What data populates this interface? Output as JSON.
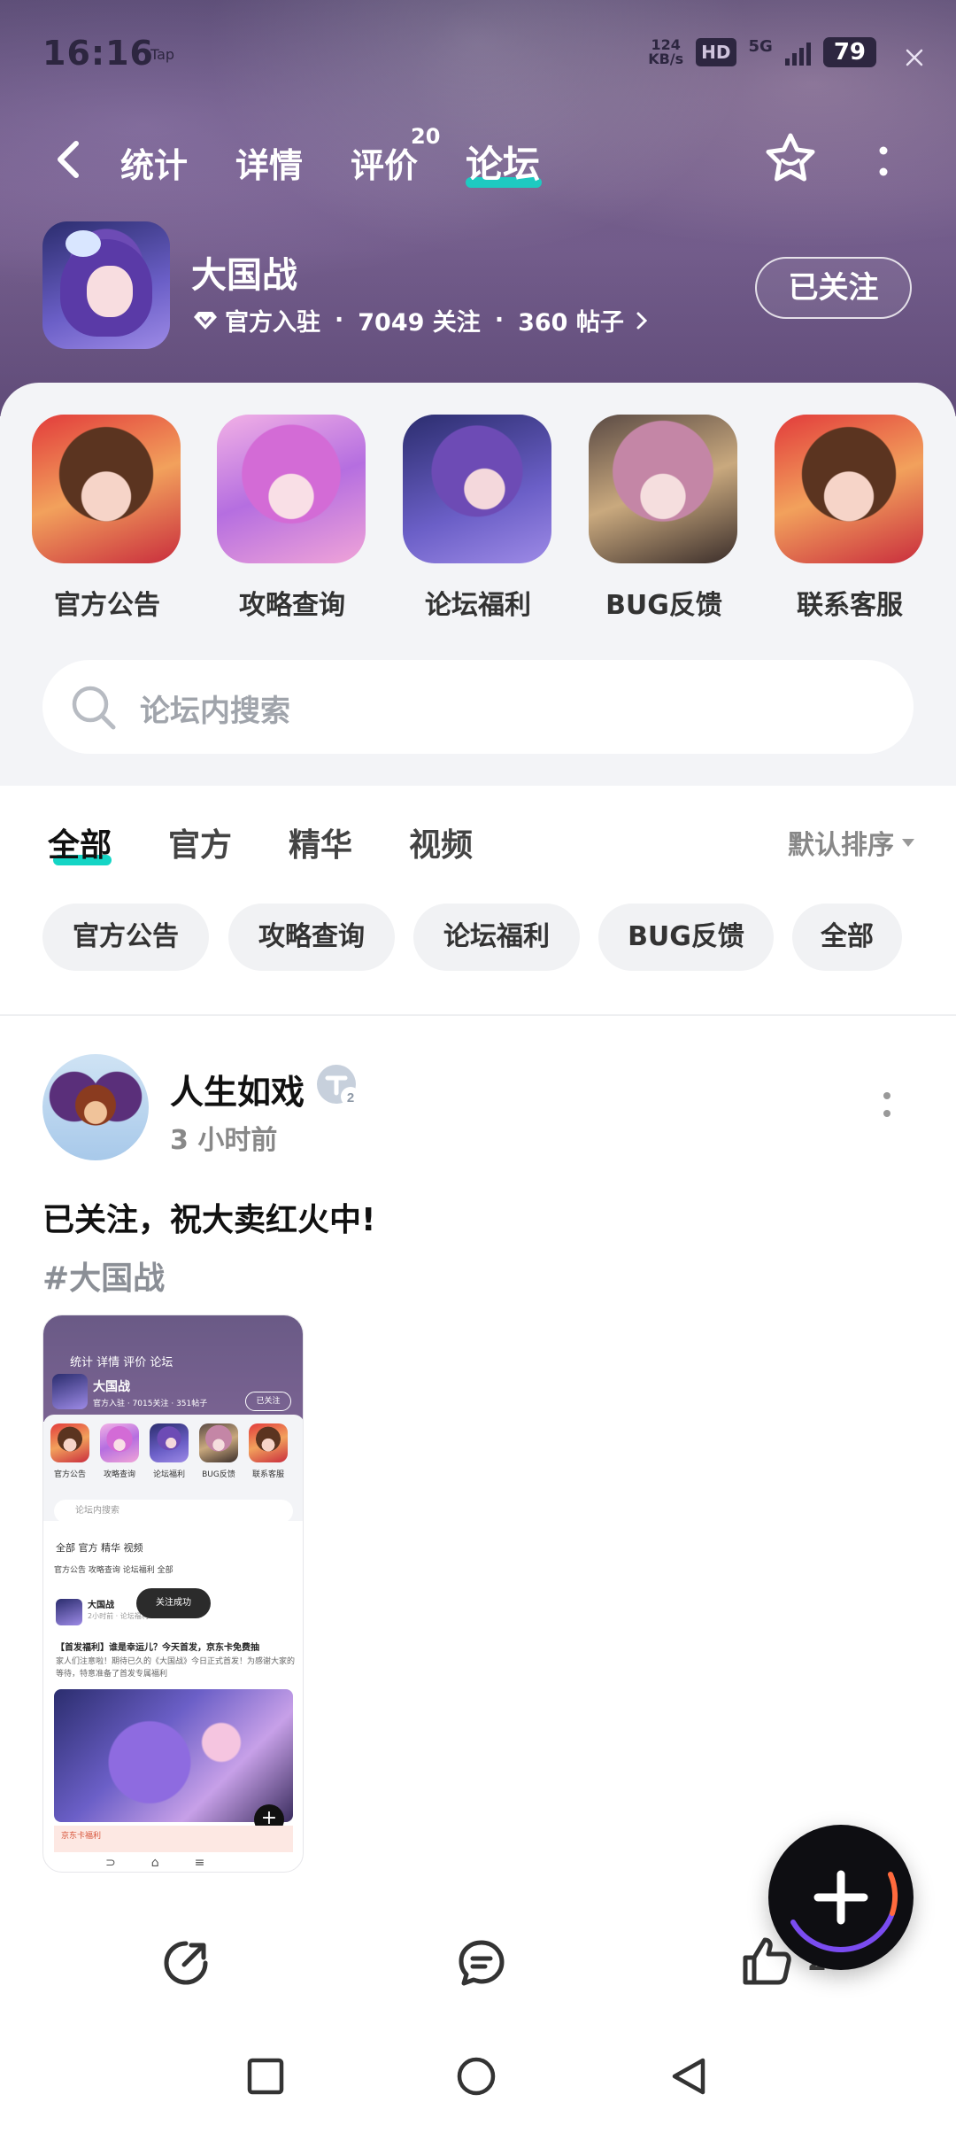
{
  "status_bar": {
    "time": "16:16",
    "app_hint": "Tap",
    "net_speed_top": "124",
    "net_speed_unit": "KB/s",
    "hd": "HD",
    "network": "5G",
    "battery": "79"
  },
  "nav": {
    "tabs": [
      {
        "label": "统计"
      },
      {
        "label": "详情"
      },
      {
        "label": "评价",
        "badge": "20"
      },
      {
        "label": "论坛",
        "active": true
      }
    ]
  },
  "game": {
    "title": "大国战",
    "official": "官方入驻",
    "followers": "7049 关注",
    "posts": "360 帖子",
    "follow_button": "已关注"
  },
  "quick_links": [
    {
      "label": "官方公告"
    },
    {
      "label": "攻略查询"
    },
    {
      "label": "论坛福利"
    },
    {
      "label": "BUG反馈"
    },
    {
      "label": "联系客服"
    }
  ],
  "search": {
    "placeholder": "论坛内搜索"
  },
  "filter_tabs": [
    {
      "label": "全部",
      "active": true
    },
    {
      "label": "官方"
    },
    {
      "label": "精华"
    },
    {
      "label": "视频"
    }
  ],
  "sort": {
    "label": "默认排序"
  },
  "chips": [
    "官方公告",
    "攻略查询",
    "论坛福利",
    "BUG反馈",
    "全部"
  ],
  "post": {
    "user": "人生如戏",
    "level": "2",
    "time": "3 小时前",
    "text": "已关注，祝大卖红火中!",
    "tag": "#大国战",
    "likes": "2",
    "screenshot": {
      "tabs": "统计  详情  评价  论坛",
      "title": "大国战",
      "meta": "官方入驻 · 7015关注 · 351帖子",
      "follow": "已关注",
      "quick": [
        "官方公告",
        "攻略查询",
        "论坛福利",
        "BUG反馈",
        "联系客服"
      ],
      "search": "论坛内搜索",
      "filters": "全部   官方   精华   视频",
      "chips": "官方公告   攻略查询   论坛福利   全部",
      "post_user": "大国战",
      "post_time": "2小时前 · 论坛福利",
      "toast": "关注成功",
      "post_title": "【首发福利】谁是幸运儿？今天首发，京东卡免费抽",
      "post_body": "家人们注意啦！期待已久的《大国战》今日正式首发！为感谢大家的等待，特意准备了首发专属福利",
      "promo": "京东卡福利"
    }
  },
  "colors": {
    "accent": "#14d5c5",
    "banner": "#6e5788",
    "fab": "#0e0e12"
  }
}
